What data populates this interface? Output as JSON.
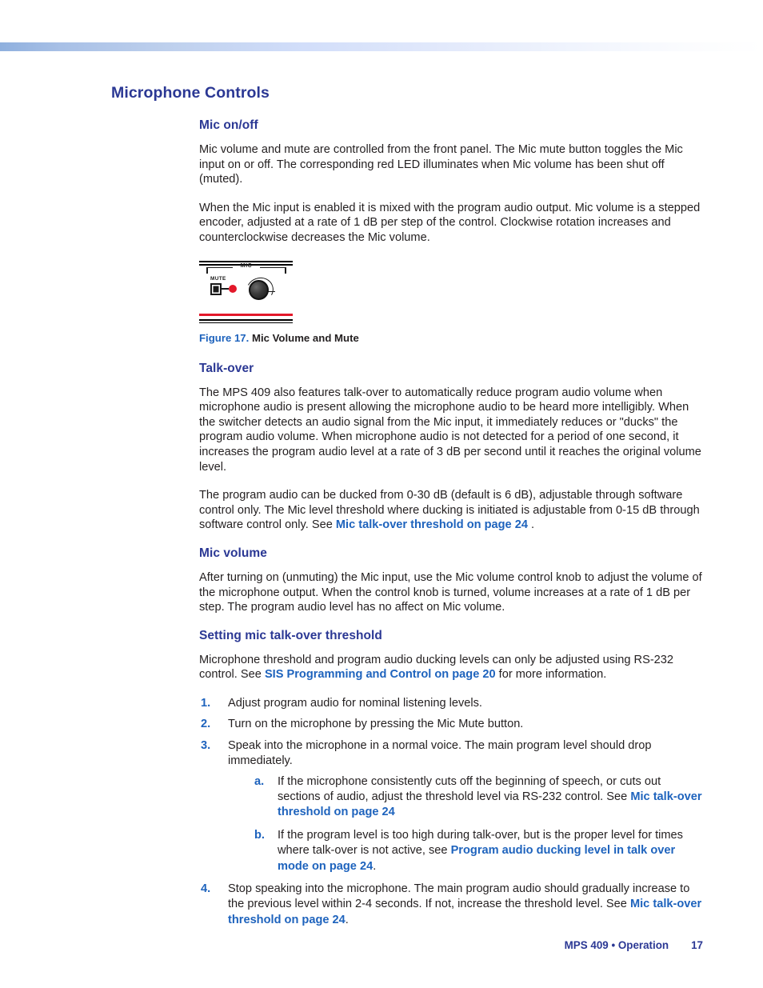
{
  "document": {
    "chapter_heading": "Microphone Controls",
    "sections": [
      {
        "heading": "Mic on/off",
        "paragraphs": [
          "Mic volume and mute are controlled from the front panel. The Mic mute button toggles the Mic input on or off. The corresponding red LED illuminates when Mic volume has been shut off (muted).",
          "When the Mic input is enabled it is mixed with the program audio output. Mic volume is a stepped encoder, adjusted at a rate of 1 dB per step of the control. Clockwise rotation increases and counterclockwise decreases the Mic volume."
        ]
      },
      {
        "heading": "Talk-over",
        "paragraphs": [
          "The MPS 409 also features talk-over to automatically reduce program audio volume when microphone audio is present allowing the microphone audio to be heard more intelligibly. When the switcher detects an audio signal from the Mic input, it immediately reduces or \"ducks\" the program audio volume. When microphone audio is not detected for a period of one second, it increases the program audio level at a rate of 3 dB per second until it reaches the original volume level."
        ]
      },
      {
        "heading": "Mic volume",
        "paragraphs": [
          "After turning on (unmuting) the Mic input, use the Mic volume control knob to adjust the volume of the microphone output. When the control knob is turned, volume increases at a rate of 1 dB per step. The program audio level has no affect on Mic volume."
        ]
      },
      {
        "heading": "Setting mic talk-over threshold",
        "paragraphs": []
      }
    ],
    "talkover_ducking": {
      "text_before": "The program audio can be ducked from 0-30 dB (default is 6 dB), adjustable through software control only. The Mic level threshold where ducking is initiated is adjustable from 0-15 dB through software control only. See ",
      "link": "Mic talk-over threshold on page 24",
      "text_after": " ."
    },
    "threshold_intro": {
      "text_before": "Microphone threshold and program audio ducking levels can only be adjusted using RS-232 control. See ",
      "link": "SIS Programming and Control on page 20",
      "text_after": " for more information."
    },
    "figure": {
      "number": "Figure 17.",
      "caption": "Mic Volume and Mute",
      "panel": {
        "bracket_label": "MIC",
        "mute_label": "MUTE"
      }
    },
    "steps": [
      {
        "num": "1.",
        "text": "Adjust program audio for nominal listening levels."
      },
      {
        "num": "2.",
        "text": "Turn on the microphone by pressing the Mic Mute button."
      },
      {
        "num": "3.",
        "text": "Speak into the microphone in a normal voice. The main program level should drop immediately.",
        "substeps": [
          {
            "num": "a.",
            "text_before": "If the microphone consistently cuts off the beginning of speech, or cuts out sections of audio, adjust the threshold level via RS-232 control. See ",
            "link": "Mic talk-over threshold on page 24",
            "text_after": ""
          },
          {
            "num": "b.",
            "text_before": "If the program level is too high during talk-over, but is the proper level for times where talk-over is not active, see ",
            "link": "Program audio ducking level in talk over mode on page 24",
            "text_after": "."
          }
        ]
      },
      {
        "num": "4.",
        "text_before": "Stop speaking into the microphone. The main program audio should gradually increase to the previous level within 2-4 seconds. If not, increase the threshold level. See ",
        "link": "Mic talk-over threshold on page 24",
        "text_after": "."
      }
    ],
    "footer": {
      "doc_title": "MPS 409 • Operation",
      "page_number": "17"
    },
    "colors": {
      "heading_blue": "#2b3894",
      "link_blue": "#1e63bd",
      "led_red": "#e3182a",
      "body_text": "#231f20"
    }
  }
}
